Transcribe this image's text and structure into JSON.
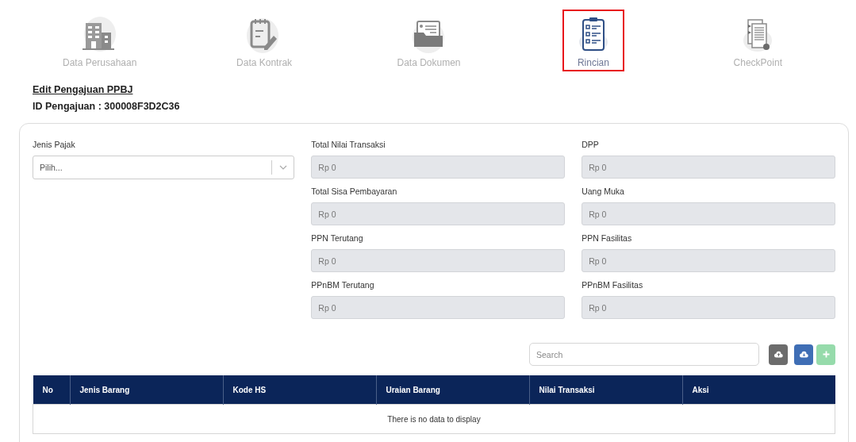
{
  "steps": [
    {
      "kind": "building",
      "label": "Data Perusahaan",
      "selected": false
    },
    {
      "kind": "contract",
      "label": "Data Kontrak",
      "selected": false
    },
    {
      "kind": "folder",
      "label": "Data Dokumen",
      "selected": false
    },
    {
      "kind": "checklist",
      "label": "Rincian",
      "selected": true
    },
    {
      "kind": "checkpoint",
      "label": "CheckPoint",
      "selected": false
    }
  ],
  "page_title": "Edit Pengajuan PPBJ",
  "submission_id": "ID Pengajuan : 300008F3D2C36",
  "jenis_pajak": {
    "label": "Jenis Pajak",
    "placeholder": "Pilih..."
  },
  "amount_fields": [
    {
      "label": "Total Nilai Transaksi",
      "value": "Rp 0"
    },
    {
      "label": "DPP",
      "value": "Rp 0"
    },
    {
      "label": "Total Sisa Pembayaran",
      "value": "Rp 0"
    },
    {
      "label": "Uang Muka",
      "value": "Rp 0"
    },
    {
      "label": "PPN Terutang",
      "value": "Rp 0"
    },
    {
      "label": "PPN Fasilitas",
      "value": "Rp 0"
    },
    {
      "label": "PPnBM Terutang",
      "value": "Rp 0"
    },
    {
      "label": "PPnBM Fasilitas",
      "value": "Rp 0"
    }
  ],
  "search": {
    "placeholder": "Search"
  },
  "toolbar_buttons": [
    {
      "kind": "upload",
      "disabled": false
    },
    {
      "kind": "download",
      "disabled": false
    },
    {
      "kind": "add",
      "disabled": true
    }
  ],
  "table": {
    "columns": [
      "No",
      "Jenis Barang",
      "Kode HS",
      "Uraian Barang",
      "Nilai Transaksi",
      "Aksi"
    ],
    "empty_message": "There is no data to display"
  }
}
